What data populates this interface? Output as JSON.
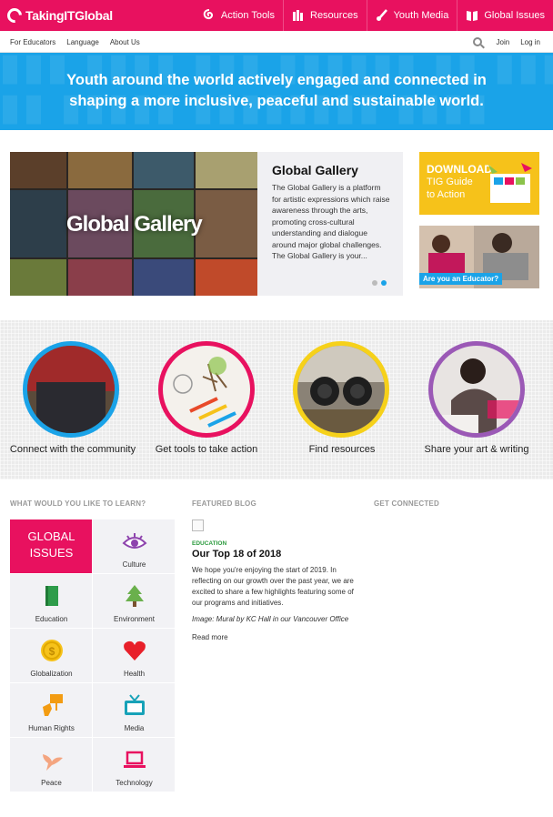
{
  "header": {
    "logo_text": "TakingITGlobal",
    "nav": [
      {
        "label": "Action Tools",
        "icon": "spiral-icon"
      },
      {
        "label": "Resources",
        "icon": "hands-icon"
      },
      {
        "label": "Youth Media",
        "icon": "brush-icon"
      },
      {
        "label": "Global Issues",
        "icon": "book-icon"
      }
    ],
    "accent": "#e8115f"
  },
  "subnav": {
    "left": [
      "For Educators",
      "Language",
      "About Us"
    ],
    "join": "Join",
    "login": "Log in"
  },
  "hero": {
    "text": "Youth around the world actively engaged and connected in shaping a more inclusive, peaceful and sustainable world.",
    "color": "#1aa3e8"
  },
  "slider": {
    "image_label": "Global Gallery",
    "title": "Global Gallery",
    "description": "The Global Gallery is a platform for artistic expressions which raise awareness through the arts, promoting cross-cultural understanding and dialogue around major global challenges. The Global Gallery is your...",
    "slides": 2,
    "active_slide": 2
  },
  "promos": {
    "download_title": "DOWNLOAD",
    "download_sub": "TIG Guide to Action",
    "educator": "Are you an Educator?"
  },
  "circles": [
    {
      "label": "Connect with the community",
      "color": "#1aa3e8"
    },
    {
      "label": "Get tools to take action",
      "color": "#e8115f"
    },
    {
      "label": "Find resources",
      "color": "#f6d11a"
    },
    {
      "label": "Share your art & writing",
      "color": "#9b59b6"
    }
  ],
  "learn": {
    "heading": "WHAT WOULD YOU LIKE TO LEARN?",
    "global_issues_line1": "GLOBAL",
    "global_issues_line2": "ISSUES",
    "topics": [
      {
        "label": "Culture",
        "icon": "eye-icon"
      },
      {
        "label": "Education",
        "icon": "book-icon"
      },
      {
        "label": "Environment",
        "icon": "tree-icon"
      },
      {
        "label": "Globalization",
        "icon": "coin-icon"
      },
      {
        "label": "Health",
        "icon": "heart-icon"
      },
      {
        "label": "Human Rights",
        "icon": "protest-sign-icon"
      },
      {
        "label": "Media",
        "icon": "tv-icon"
      },
      {
        "label": "Peace",
        "icon": "dove-icon"
      },
      {
        "label": "Technology",
        "icon": "laptop-icon"
      }
    ]
  },
  "blog": {
    "heading": "FEATURED BLOG",
    "category": "EDUCATION",
    "title": "Our Top 18 of 2018",
    "excerpt": "We hope you're enjoying the start of 2019. In reflecting on our growth over the past year, we are excited to share a few highlights featuring some of our programs and initiatives.",
    "caption": "Image: Mural by KC Hall in our Vancouver Office",
    "read_more": "Read more"
  },
  "connected": {
    "heading": "GET CONNECTED"
  }
}
